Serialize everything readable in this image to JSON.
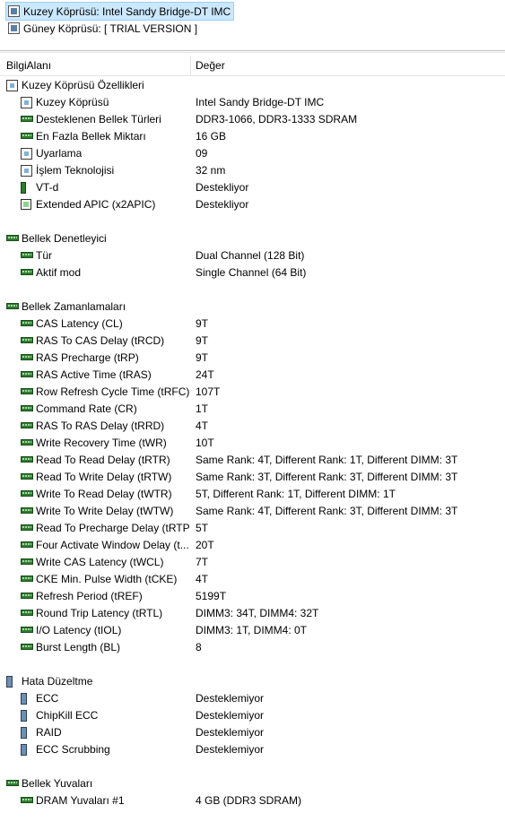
{
  "top_tree": [
    {
      "label": "Kuzey Köprüsü: Intel Sandy Bridge-DT IMC",
      "icon": "chip-icon",
      "selected": true
    },
    {
      "label": "Güney Köprüsü: [ TRIAL VERSION ]",
      "icon": "chip-icon",
      "selected": false
    }
  ],
  "columns": {
    "field": "BilgiAlanı",
    "value": "Değer"
  },
  "rows": [
    {
      "type": "group",
      "label": "Kuzey Köprüsü Özellikleri",
      "value": "",
      "icon": "chip-icon"
    },
    {
      "type": "item",
      "label": "Kuzey Köprüsü",
      "value": "Intel Sandy Bridge-DT IMC",
      "icon": "chip-icon"
    },
    {
      "type": "item",
      "label": "Desteklenen Bellek Türleri",
      "value": "DDR3-1066, DDR3-1333 SDRAM",
      "icon": "ram-icon"
    },
    {
      "type": "item",
      "label": "En Fazla Bellek Miktarı",
      "value": "16 GB",
      "icon": "ram-icon"
    },
    {
      "type": "item",
      "label": "Uyarlama",
      "value": "09",
      "icon": "chip-icon"
    },
    {
      "type": "item",
      "label": "İşlem Teknolojisi",
      "value": "32 nm",
      "icon": "chip-icon"
    },
    {
      "type": "item",
      "label": "VT-d",
      "value": "Destekliyor",
      "icon": "vtd-icon"
    },
    {
      "type": "item",
      "label": "Extended APIC (x2APIC)",
      "value": "Destekliyor",
      "icon": "apic-icon"
    },
    {
      "type": "blank"
    },
    {
      "type": "group",
      "label": "Bellek Denetleyici",
      "value": "",
      "icon": "ram-icon"
    },
    {
      "type": "item",
      "label": "Tür",
      "value": "Dual Channel  (128 Bit)",
      "icon": "ram-icon"
    },
    {
      "type": "item",
      "label": "Aktif mod",
      "value": "Single Channel  (64 Bit)",
      "icon": "ram-icon"
    },
    {
      "type": "blank"
    },
    {
      "type": "group",
      "label": "Bellek Zamanlamaları",
      "value": "",
      "icon": "ram-icon"
    },
    {
      "type": "item",
      "label": "CAS Latency (CL)",
      "value": "9T",
      "icon": "ram-icon"
    },
    {
      "type": "item",
      "label": "RAS To CAS Delay (tRCD)",
      "value": "9T",
      "icon": "ram-icon"
    },
    {
      "type": "item",
      "label": "RAS Precharge (tRP)",
      "value": "9T",
      "icon": "ram-icon"
    },
    {
      "type": "item",
      "label": "RAS Active Time (tRAS)",
      "value": "24T",
      "icon": "ram-icon"
    },
    {
      "type": "item",
      "label": "Row Refresh Cycle Time (tRFC)",
      "value": "107T",
      "icon": "ram-icon"
    },
    {
      "type": "item",
      "label": "Command Rate (CR)",
      "value": "1T",
      "icon": "ram-icon"
    },
    {
      "type": "item",
      "label": "RAS To RAS Delay (tRRD)",
      "value": "4T",
      "icon": "ram-icon"
    },
    {
      "type": "item",
      "label": "Write Recovery Time (tWR)",
      "value": "10T",
      "icon": "ram-icon"
    },
    {
      "type": "item",
      "label": "Read To Read Delay (tRTR)",
      "value": "Same Rank: 4T, Different Rank: 1T, Different DIMM: 3T",
      "icon": "ram-icon"
    },
    {
      "type": "item",
      "label": "Read To Write Delay (tRTW)",
      "value": "Same Rank: 3T, Different Rank: 3T, Different DIMM: 3T",
      "icon": "ram-icon"
    },
    {
      "type": "item",
      "label": "Write To Read Delay (tWTR)",
      "value": "5T, Different Rank: 1T, Different DIMM: 1T",
      "icon": "ram-icon"
    },
    {
      "type": "item",
      "label": "Write To Write Delay (tWTW)",
      "value": "Same Rank: 4T, Different Rank: 3T, Different DIMM: 3T",
      "icon": "ram-icon"
    },
    {
      "type": "item",
      "label": "Read To Precharge Delay (tRTP)",
      "value": "5T",
      "icon": "ram-icon"
    },
    {
      "type": "item",
      "label": "Four Activate Window Delay (t...",
      "value": "20T",
      "icon": "ram-icon"
    },
    {
      "type": "item",
      "label": "Write CAS Latency (tWCL)",
      "value": "7T",
      "icon": "ram-icon"
    },
    {
      "type": "item",
      "label": "CKE Min. Pulse Width (tCKE)",
      "value": "4T",
      "icon": "ram-icon"
    },
    {
      "type": "item",
      "label": "Refresh Period (tREF)",
      "value": "5199T",
      "icon": "ram-icon"
    },
    {
      "type": "item",
      "label": "Round Trip Latency (tRTL)",
      "value": "DIMM3: 34T, DIMM4: 32T",
      "icon": "ram-icon"
    },
    {
      "type": "item",
      "label": "I/O Latency (tIOL)",
      "value": "DIMM3: 1T, DIMM4: 0T",
      "icon": "ram-icon"
    },
    {
      "type": "item",
      "label": "Burst Length (BL)",
      "value": "8",
      "icon": "ram-icon"
    },
    {
      "type": "blank"
    },
    {
      "type": "group",
      "label": "Hata Düzeltme",
      "value": "",
      "icon": "memory-stick-icon"
    },
    {
      "type": "item",
      "label": "ECC",
      "value": "Desteklemiyor",
      "icon": "memory-stick-icon"
    },
    {
      "type": "item",
      "label": "ChipKill ECC",
      "value": "Desteklemiyor",
      "icon": "memory-stick-icon"
    },
    {
      "type": "item",
      "label": "RAID",
      "value": "Desteklemiyor",
      "icon": "memory-stick-icon"
    },
    {
      "type": "item",
      "label": "ECC Scrubbing",
      "value": "Desteklemiyor",
      "icon": "memory-stick-icon"
    },
    {
      "type": "blank"
    },
    {
      "type": "group",
      "label": "Bellek Yuvaları",
      "value": "",
      "icon": "ram-icon"
    },
    {
      "type": "item",
      "label": "DRAM Yuvaları #1",
      "value": "4 GB  (DDR3 SDRAM)",
      "icon": "ram-icon"
    }
  ]
}
